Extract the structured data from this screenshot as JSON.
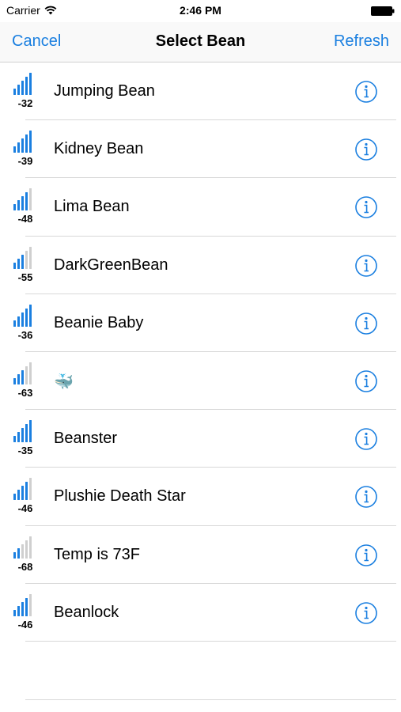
{
  "status_bar": {
    "carrier": "Carrier",
    "time": "2:46 PM"
  },
  "nav": {
    "cancel_label": "Cancel",
    "title": "Select Bean",
    "refresh_label": "Refresh"
  },
  "colors": {
    "accent": "#1a7fe0",
    "signal_inactive": "#cfcfcf"
  },
  "beans": [
    {
      "name": "Jumping Bean",
      "rssi": "-32",
      "signal_bars": 5
    },
    {
      "name": "Kidney Bean",
      "rssi": "-39",
      "signal_bars": 5
    },
    {
      "name": "Lima Bean",
      "rssi": "-48",
      "signal_bars": 4
    },
    {
      "name": "DarkGreenBean",
      "rssi": "-55",
      "signal_bars": 3
    },
    {
      "name": "Beanie Baby",
      "rssi": "-36",
      "signal_bars": 5
    },
    {
      "name": "🐳",
      "rssi": "-63",
      "signal_bars": 3
    },
    {
      "name": "Beanster",
      "rssi": "-35",
      "signal_bars": 5
    },
    {
      "name": "Plushie Death Star",
      "rssi": "-46",
      "signal_bars": 4
    },
    {
      "name": "Temp is 73F",
      "rssi": "-68",
      "signal_bars": 2
    },
    {
      "name": "Beanlock",
      "rssi": "-46",
      "signal_bars": 4
    }
  ],
  "icons": {
    "info": "info-circle-icon",
    "signal": "signal-strength-icon",
    "wifi": "wifi-icon",
    "battery": "battery-icon"
  }
}
